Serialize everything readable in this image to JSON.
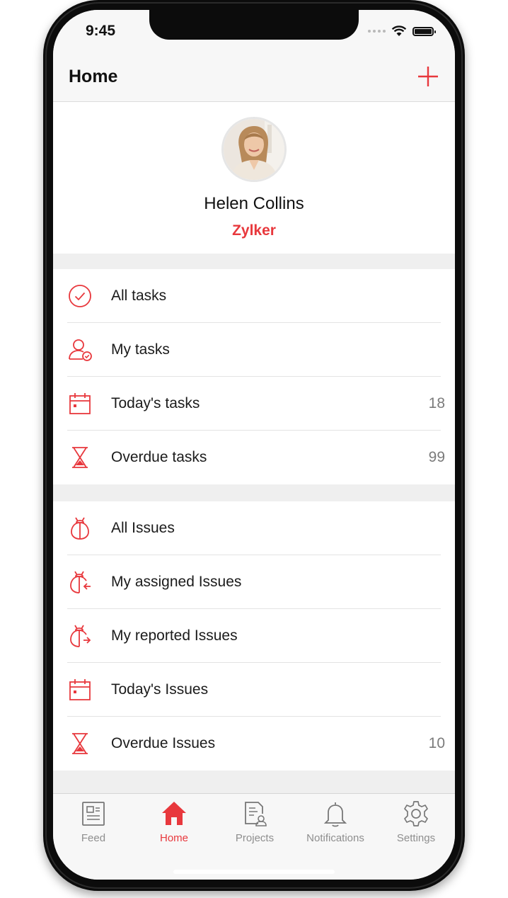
{
  "status_bar": {
    "time": "9:45"
  },
  "nav": {
    "title": "Home",
    "add_icon": "plus-icon"
  },
  "profile": {
    "name": "Helen Collins",
    "company": "Zylker"
  },
  "tasks": [
    {
      "label": "All tasks",
      "icon": "check-circle-icon",
      "count": ""
    },
    {
      "label": "My tasks",
      "icon": "user-check-icon",
      "count": ""
    },
    {
      "label": "Today's tasks",
      "icon": "calendar-icon",
      "count": "18"
    },
    {
      "label": "Overdue tasks",
      "icon": "hourglass-icon",
      "count": "99"
    }
  ],
  "issues": [
    {
      "label": "All Issues",
      "icon": "bug-icon",
      "count": ""
    },
    {
      "label": "My assigned Issues",
      "icon": "bug-assigned-icon",
      "count": ""
    },
    {
      "label": "My reported Issues",
      "icon": "bug-reported-icon",
      "count": ""
    },
    {
      "label": "Today's Issues",
      "icon": "calendar-icon",
      "count": ""
    },
    {
      "label": "Overdue Issues",
      "icon": "hourglass-icon",
      "count": "10"
    }
  ],
  "tab_bar": [
    {
      "label": "Feed",
      "icon": "feed-icon",
      "active": false
    },
    {
      "label": "Home",
      "icon": "home-icon",
      "active": true
    },
    {
      "label": "Projects",
      "icon": "projects-icon",
      "active": false
    },
    {
      "label": "Notifications",
      "icon": "bell-icon",
      "active": false
    },
    {
      "label": "Settings",
      "icon": "gear-icon",
      "active": false
    }
  ],
  "colors": {
    "accent": "#e8383d",
    "text": "#1b1b1b",
    "muted": "#8e8e8e",
    "separator": "#efefef"
  }
}
